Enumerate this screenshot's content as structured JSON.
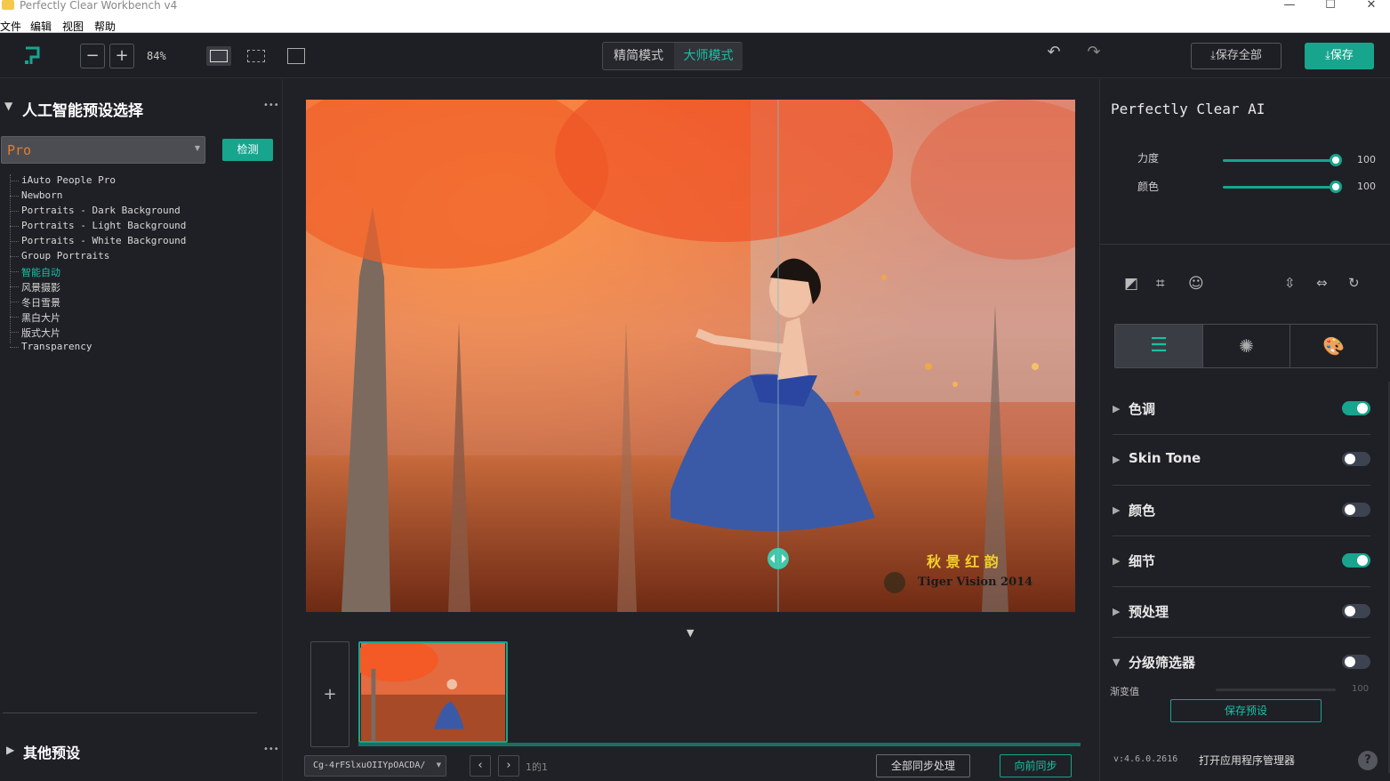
{
  "window": {
    "title": "Perfectly Clear Workbench v4",
    "minimize": "—",
    "maximize": "☐",
    "close": "✕"
  },
  "menu": [
    "文件",
    "编辑",
    "视图",
    "帮助"
  ],
  "toolbar": {
    "zoom_out": "−",
    "zoom_in": "+",
    "zoom": "84%",
    "mode_simple": "精简模式",
    "mode_master": "大师模式",
    "save_all": "保存全部",
    "save": "保存",
    "accent": "#17a58e"
  },
  "left": {
    "ai_presets_title": "人工智能预设选择",
    "preset_select": "Pro",
    "detect_button": "检测",
    "presets": [
      "iAuto People Pro",
      "Newborn",
      "Portraits - Dark Background",
      "Portraits - Light Background",
      "Portraits - White Background",
      "Group Portraits",
      "智能自动",
      "风景摄影",
      "冬日雪景",
      "黑白大片",
      "版式大片",
      "Transparency"
    ],
    "selected_preset_index": 6,
    "other_presets_title": "其他预设",
    "more": "•••"
  },
  "center": {
    "add_image": "+",
    "file_select": "Cg-4rFSlxuOIIYpOACDA/",
    "page_counter": "1的1",
    "sync_all": "全部同步处理",
    "sync_forward": "向前同步",
    "watermark_line1": "秋 景 红 韵",
    "watermark_line2": "Tiger Vision 2014"
  },
  "right": {
    "panel_title": "Perfectly Clear AI",
    "sliders": [
      {
        "label": "力度",
        "value": "100"
      },
      {
        "label": "颜色",
        "value": "100"
      }
    ],
    "sections": [
      {
        "label": "色调",
        "on": true
      },
      {
        "label": "Skin Tone",
        "on": false
      },
      {
        "label": "颜色",
        "on": false
      },
      {
        "label": "细节",
        "on": true
      },
      {
        "label": "预处理",
        "on": false
      },
      {
        "label": "分级筛选器",
        "on": false
      }
    ],
    "gradient_label": "渐变值",
    "gradient_value": "100",
    "save_preset": "保存预设",
    "version": "v:4.6.0.2616",
    "open_manager": "打开应用程序管理器",
    "help": "?"
  }
}
